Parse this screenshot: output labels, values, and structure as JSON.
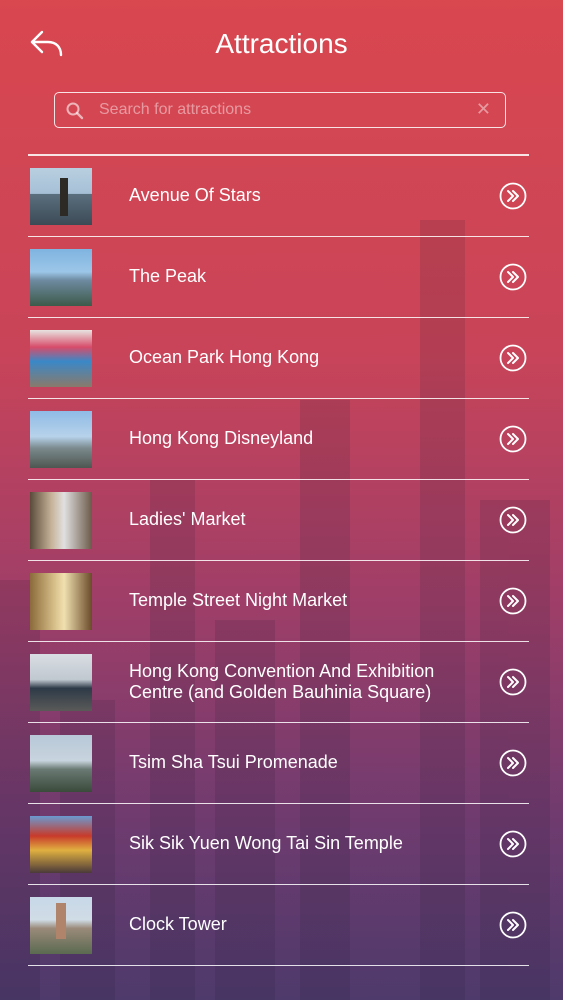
{
  "header": {
    "title": "Attractions",
    "back_icon": "back-reply-arrow-icon"
  },
  "search": {
    "placeholder": "Search for attractions",
    "value": "",
    "icon": "search-icon",
    "clear_icon": "clear-x-icon"
  },
  "attractions": [
    {
      "name": "Avenue Of Stars"
    },
    {
      "name": "The Peak"
    },
    {
      "name": "Ocean Park Hong Kong"
    },
    {
      "name": "Hong Kong Disneyland"
    },
    {
      "name": "Ladies' Market"
    },
    {
      "name": "Temple Street Night Market"
    },
    {
      "name": "Hong Kong Convention And Exhibition Centre (and Golden Bauhinia Square)"
    },
    {
      "name": "Tsim Sha Tsui Promenade"
    },
    {
      "name": "Sik Sik Yuen Wong Tai Sin Temple"
    },
    {
      "name": "Clock Tower"
    }
  ],
  "colors": {
    "gradient_top": "#d9474f",
    "gradient_bottom": "#4e3a6b",
    "text": "#ffffff"
  }
}
